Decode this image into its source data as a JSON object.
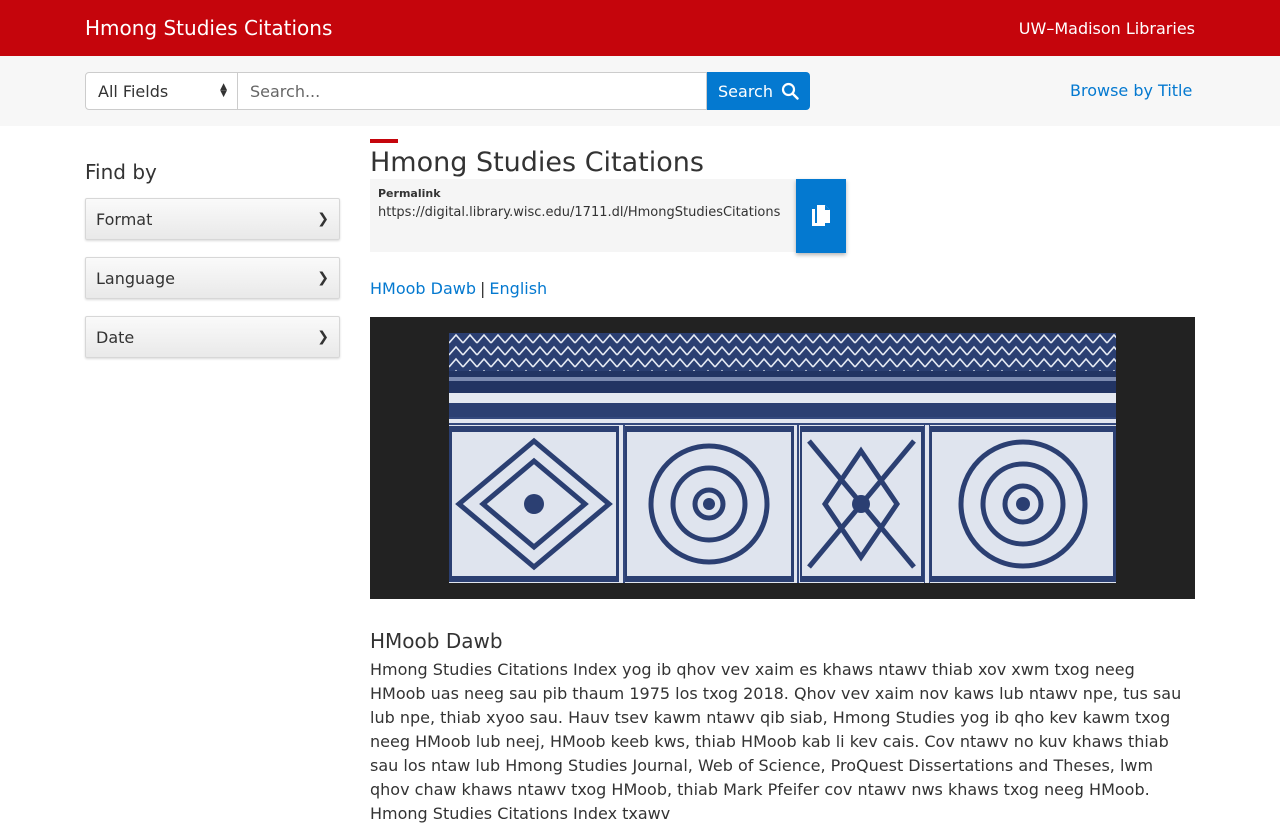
{
  "header": {
    "site_title": "Hmong Studies Citations",
    "institution_link": "UW–Madison Libraries",
    "brand_color": "#c5050c"
  },
  "search": {
    "field_select_value": "All Fields",
    "placeholder": "Search...",
    "button_label": "Search",
    "browse_link": "Browse by Title",
    "accent_color": "#0479d0"
  },
  "sidebar": {
    "heading": "Find by",
    "facets": [
      {
        "label": "Format"
      },
      {
        "label": "Language"
      },
      {
        "label": "Date"
      }
    ]
  },
  "main": {
    "title": "Hmong Studies Citations",
    "permalink_label": "Permalink",
    "permalink_url": "https://digital.library.wisc.edu/1711.dl/HmongStudiesCitations",
    "copy_icon": "copy-icon",
    "lang_links": [
      "HMoob Dawb",
      "English"
    ],
    "lang_separator": "|",
    "image": "hmong-indigo-batik-textile",
    "section_heading": "HMoob Dawb",
    "body_text": "Hmong Studies Citations Index yog ib qhov vev xaim es khaws ntawv thiab xov xwm txog neeg HMoob uas neeg sau pib thaum 1975 los txog 2018. Qhov vev xaim nov kaws lub ntawv npe, tus sau lub npe, thiab xyoo sau. Hauv tsev kawm ntawv qib siab, Hmong Studies yog ib qho kev kawm txog neeg HMoob lub neej, HMoob keeb kws, thiab HMoob kab li kev cais. Cov ntawv no kuv khaws thiab sau los ntaw lub Hmong Studies Journal, Web of Science, ProQuest Dissertations and Theses, lwm qhov chaw khaws ntawv txog HMoob, thiab Mark Pfeifer cov ntawv nws khaws txog neeg HMoob. Hmong Studies Citations Index txawv"
  }
}
